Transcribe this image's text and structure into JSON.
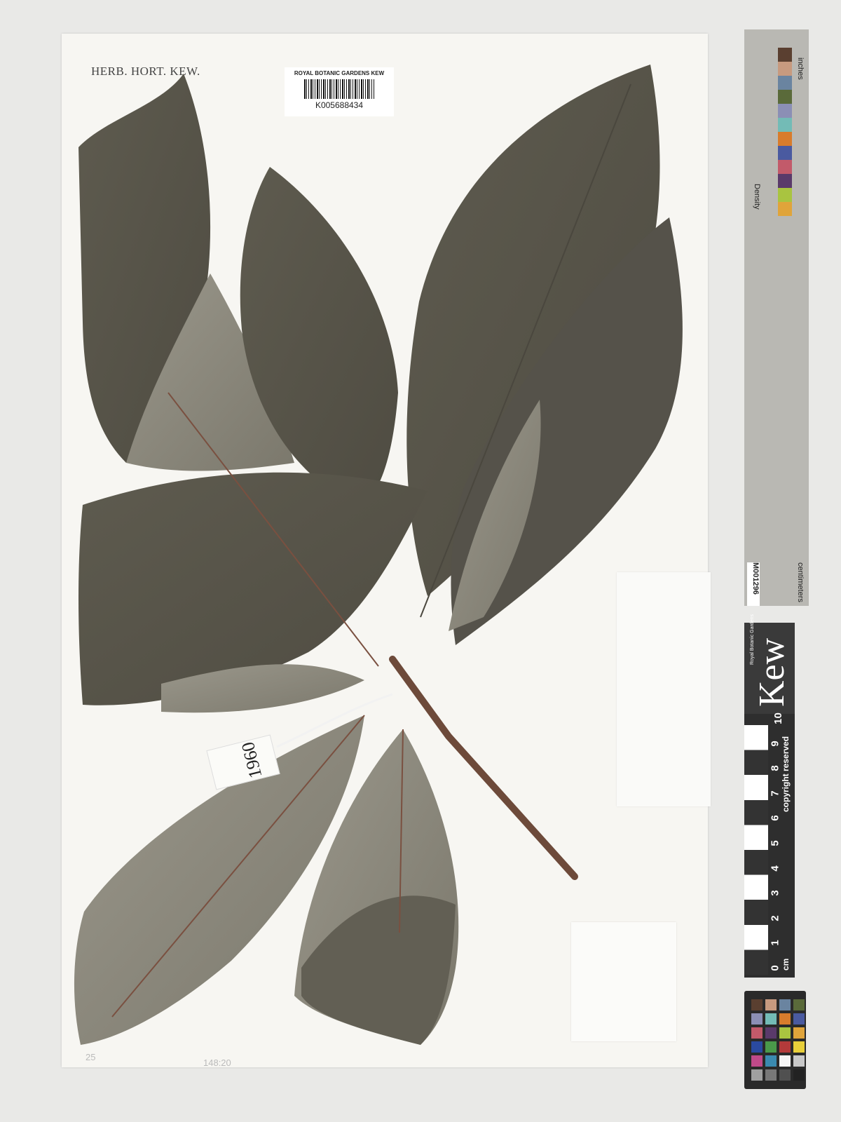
{
  "sheet": {
    "herbarium_label": "HERB. HORT. KEW.",
    "barcode_institution": "ROYAL BOTANIC GARDENS KEW",
    "barcode_number": "K005688434",
    "tag_number": "1960",
    "pencil_bottom_left": "25",
    "pencil_bottom_center": "148:20"
  },
  "color_strip": {
    "top_label": "inches",
    "bottom_label": "centimeters",
    "id": "M001296",
    "density_label": "Density"
  },
  "kew_scale": {
    "brand": "Kew",
    "sub": "Royal Botanic Gardens",
    "copyright": "copyright reserved",
    "unit": "cm",
    "ticks": [
      "0",
      "1",
      "2",
      "3",
      "4",
      "5",
      "6",
      "7",
      "8",
      "9",
      "10"
    ]
  },
  "colors": {
    "leaf_dark": "#585549",
    "leaf_light": "#8d8a7e",
    "stem": "#6d4a3a",
    "sheet": "#f7f6f2"
  },
  "checker_colors": [
    "#5a3f30",
    "#c79a7f",
    "#6a84a0",
    "#5a6a3a",
    "#8b8fb5",
    "#73bbb6",
    "#d87c2c",
    "#4a5aa0",
    "#c25a6a",
    "#5a3a6a",
    "#a9c440",
    "#e0a43a",
    "#2a4aa0",
    "#4a9a4a",
    "#b33a3a",
    "#e8cf3a",
    "#c04a8a",
    "#3a8ab0",
    "#f4f4f4",
    "#c8c8c8",
    "#a0a0a0",
    "#787878",
    "#505050",
    "#222222"
  ]
}
